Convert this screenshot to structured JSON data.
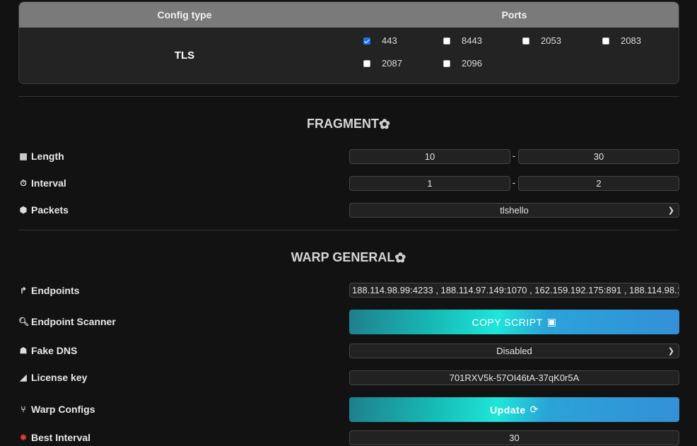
{
  "ports_table": {
    "header_config": "Config type",
    "header_ports": "Ports",
    "config_type": "TLS",
    "ports": [
      {
        "label": "443",
        "checked": true
      },
      {
        "label": "8443",
        "checked": false
      },
      {
        "label": "2053",
        "checked": false
      },
      {
        "label": "2083",
        "checked": false
      },
      {
        "label": "2087",
        "checked": false
      },
      {
        "label": "2096",
        "checked": false
      }
    ]
  },
  "fragment": {
    "title": "FRAGMENT",
    "title_icon": "gear-icon",
    "length_label": "Length",
    "length_min": "10",
    "length_max": "30",
    "interval_label": "Interval",
    "interval_min": "1",
    "interval_max": "2",
    "packets_label": "Packets",
    "packets_value": "tlshello",
    "separator": "-"
  },
  "warp": {
    "title": "WARP GENERAL",
    "title_icon": "gear-icon",
    "endpoints_label": "Endpoints",
    "endpoints_value": "188.114.98.99:4233 , 188.114.97.149:1070 , 162.159.192.175:891 , 188.114.98.1",
    "scanner_label": "Endpoint Scanner",
    "scanner_button": "COPY SCRIPT",
    "fake_dns_label": "Fake DNS",
    "fake_dns_value": "Disabled",
    "license_label": "License key",
    "license_value": "701RXV5k-57OI46tA-37qK0r5A",
    "configs_label": "Warp Configs",
    "update_button": "Update",
    "best_interval_label": "Best Interval",
    "best_interval_value": "30"
  },
  "colors": {
    "background": "#121212",
    "table_header": "#7a7a7a",
    "accent_gradient_start": "#1f7f8c",
    "accent_gradient_end": "#3490d8",
    "checkbox_checked": "#1a73e8"
  }
}
